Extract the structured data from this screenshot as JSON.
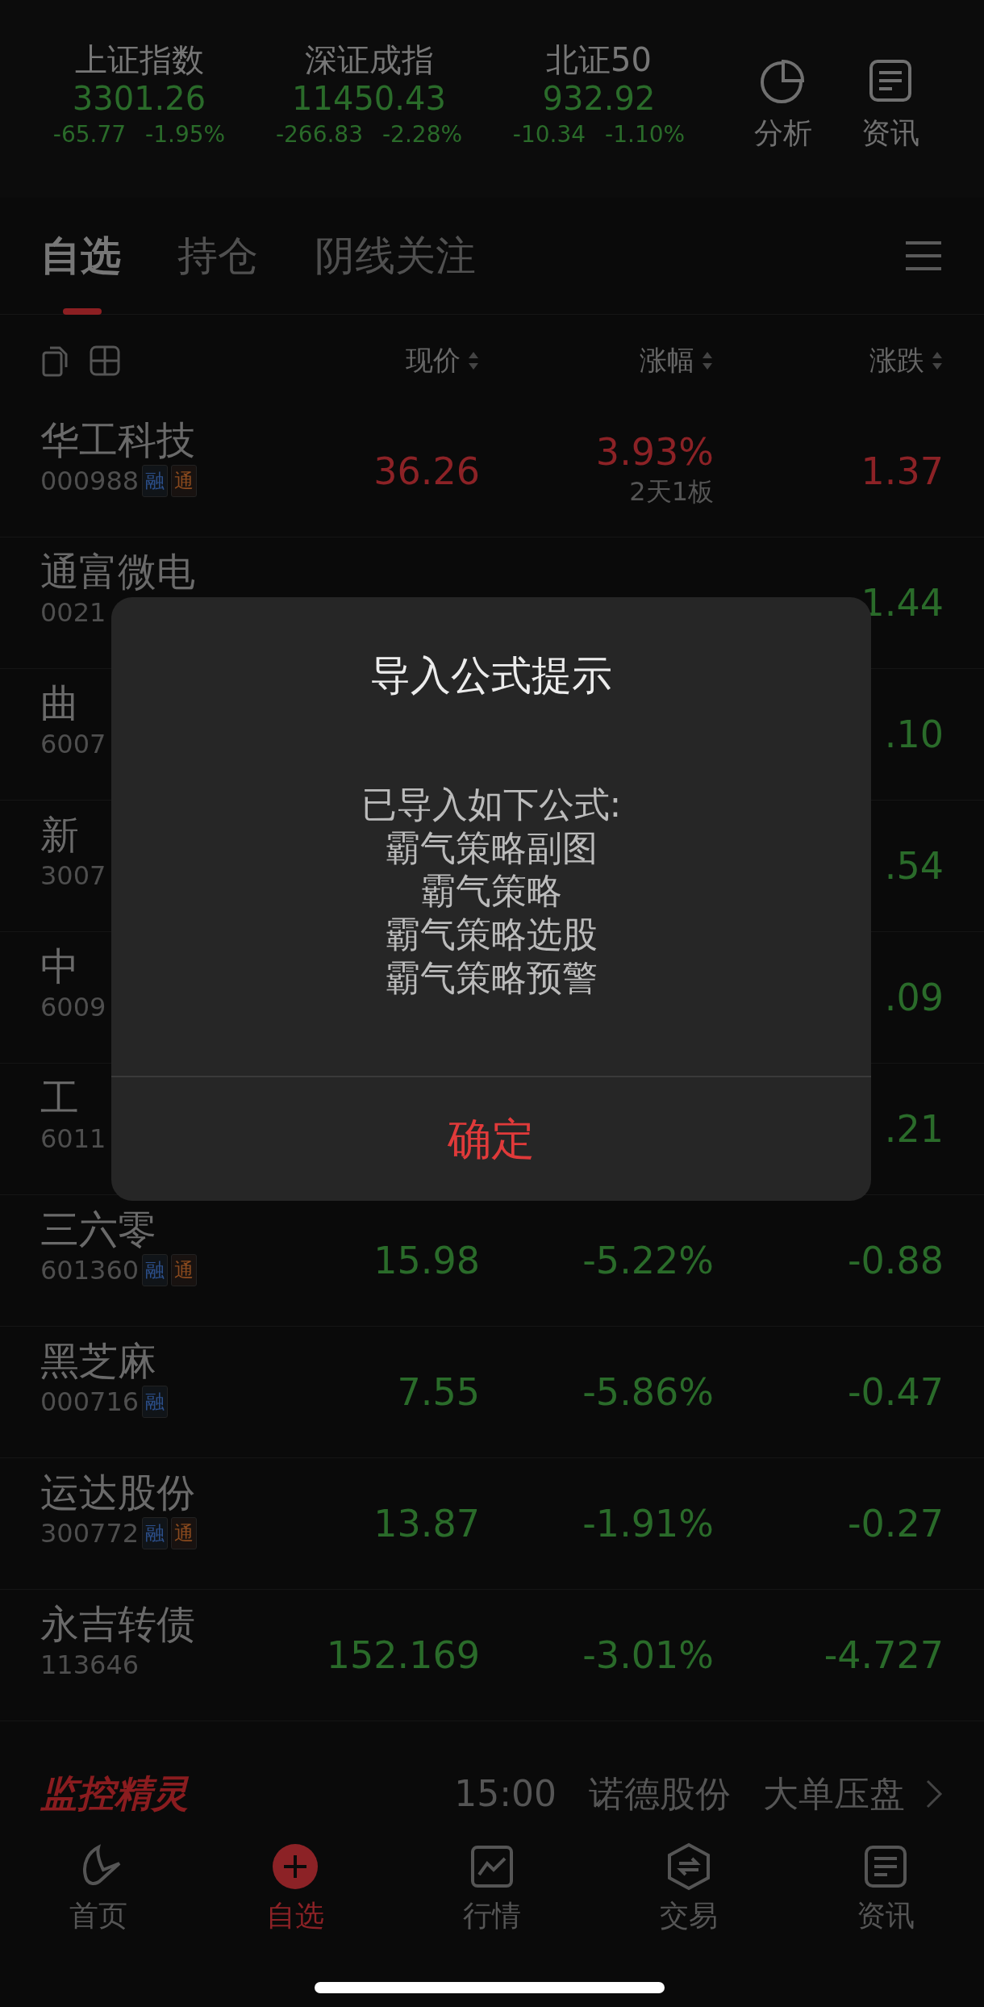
{
  "indices": [
    {
      "name": "上证指数",
      "value": "3301.26",
      "change": "-65.77",
      "percent": "-1.95%",
      "rising": false
    },
    {
      "name": "深证成指",
      "value": "11450.43",
      "change": "-266.83",
      "percent": "-2.28%",
      "rising": false
    },
    {
      "name": "北证50",
      "value": "932.92",
      "change": "-10.34",
      "percent": "-1.10%",
      "rising": false
    }
  ],
  "header_actions": [
    {
      "label": "分析",
      "kind": "pie"
    },
    {
      "label": "资讯",
      "kind": "news"
    }
  ],
  "tabs": [
    {
      "label": "自选",
      "selected": true
    },
    {
      "label": "持仓",
      "selected": false
    },
    {
      "label": "阴线关注",
      "selected": false
    }
  ],
  "columns": [
    "现价",
    "涨幅",
    "涨跌"
  ],
  "rows": [
    {
      "name": "华工科技",
      "code": "000988",
      "tags": [
        {
          "text": "融",
          "kind": "margin"
        },
        {
          "text": "通",
          "kind": "connect"
        }
      ],
      "price": "36.26",
      "percent": "3.93%",
      "note": "2天1板",
      "change": "1.37",
      "rising": true
    },
    {
      "name": "通富微电",
      "code": "0021",
      "tags": [],
      "change": "1.44",
      "rising": false
    },
    {
      "name": "曲",
      "code": "6007",
      "tags": [],
      "change": ".10",
      "rising": false
    },
    {
      "name": "新",
      "code": "3007",
      "tags": [],
      "change": ".54",
      "rising": false
    },
    {
      "name": "中",
      "code": "6009",
      "tags": [],
      "change": ".09",
      "rising": false
    },
    {
      "name": "工",
      "code": "6011",
      "tags": [],
      "change": ".21",
      "rising": false
    },
    {
      "name": "三六零",
      "code": "601360",
      "tags": [
        {
          "text": "融",
          "kind": "margin"
        },
        {
          "text": "通",
          "kind": "connect"
        }
      ],
      "price": "15.98",
      "percent": "-5.22%",
      "change": "-0.88",
      "rising": false
    },
    {
      "name": "黑芝麻",
      "code": "000716",
      "tags": [
        {
          "text": "融",
          "kind": "margin"
        }
      ],
      "price": "7.55",
      "percent": "-5.86%",
      "change": "-0.47",
      "rising": false
    },
    {
      "name": "运达股份",
      "code": "300772",
      "tags": [
        {
          "text": "融",
          "kind": "margin"
        },
        {
          "text": "通",
          "kind": "connect"
        }
      ],
      "price": "13.87",
      "percent": "-1.91%",
      "change": "-0.27",
      "rising": false
    },
    {
      "name": "永吉转债",
      "code": "113646",
      "tags": [],
      "price": "152.169",
      "percent": "-3.01%",
      "change": "-4.727",
      "rising": false
    }
  ],
  "dialog": {
    "title": "导入公式提示",
    "message_lines": [
      "已导入如下公式:",
      "霸气策略副图",
      "霸气策略",
      "霸气策略选股",
      "霸气策略预警"
    ],
    "buttons": [
      "确定"
    ]
  },
  "monitor_bar": {
    "logo": "监控精灵",
    "time": "15:00",
    "stock": "诺德股份",
    "signal": "大单压盘"
  },
  "bottom_nav": [
    {
      "label": "首页",
      "kind": "home",
      "selected": false
    },
    {
      "label": "自选",
      "kind": "add",
      "selected": true
    },
    {
      "label": "行情",
      "kind": "chart",
      "selected": false
    },
    {
      "label": "交易",
      "kind": "trade",
      "selected": false
    },
    {
      "label": "资讯",
      "kind": "news",
      "selected": false
    }
  ]
}
